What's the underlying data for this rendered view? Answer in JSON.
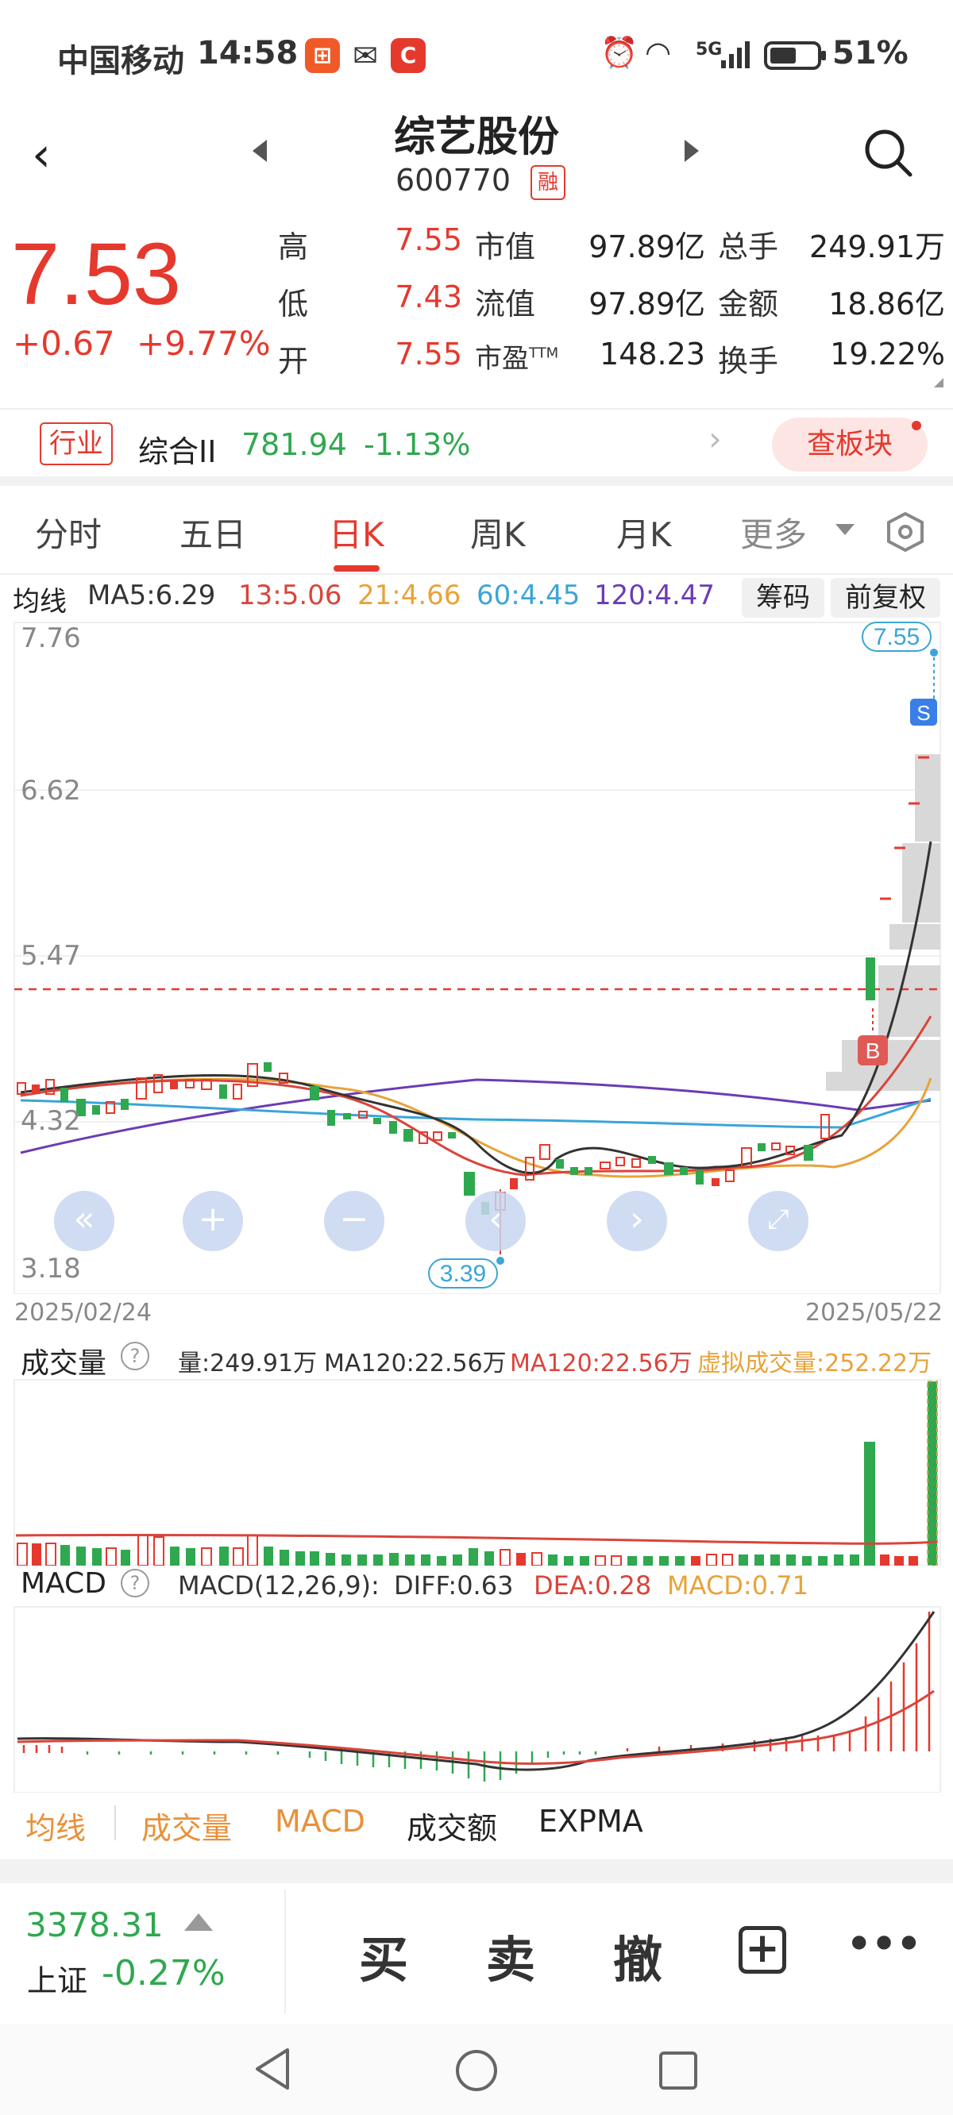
{
  "status_bar": {
    "carrier": "中国移动",
    "time": "14:58",
    "network": "5G",
    "battery": "51%"
  },
  "header": {
    "stock_name": "综艺股份",
    "stock_code": "600770",
    "margin_badge": "融"
  },
  "quote": {
    "price": "7.53",
    "change": "+0.67",
    "change_pct": "+9.77%",
    "rows": [
      [
        {
          "label": "高",
          "value": "7.55"
        },
        {
          "label": "市值",
          "value": "97.89亿"
        },
        {
          "label": "总手",
          "value": "249.91万"
        }
      ],
      [
        {
          "label": "低",
          "value": "7.43"
        },
        {
          "label": "流值",
          "value": "97.89亿"
        },
        {
          "label": "金额",
          "value": "18.86亿"
        }
      ],
      [
        {
          "label": "开",
          "value": "7.55"
        },
        {
          "label": "市盈",
          "label_sup": "TTM",
          "value": "148.23"
        },
        {
          "label": "换手",
          "value": "19.22%"
        }
      ]
    ]
  },
  "industry": {
    "badge": "行业",
    "name": "综合II",
    "value": "781.94",
    "change": "-1.13%",
    "sector_button": "查板块"
  },
  "tabs": [
    "分时",
    "五日",
    "日K",
    "周K",
    "月K",
    "更多"
  ],
  "active_tab": "日K",
  "ma_legend": {
    "label": "均线",
    "ma5": "MA5:6.29",
    "ma13": "13:5.06",
    "ma21": "21:4.66",
    "ma60": "60:4.45",
    "ma120": "120:4.47",
    "chip_button": "筹码",
    "adjust_button": "前复权"
  },
  "price_axis": [
    "7.76",
    "6.62",
    "5.47",
    "4.32",
    "3.18"
  ],
  "date_range": {
    "start": "2025/02/24",
    "end": "2025/05/22"
  },
  "markers": {
    "high_label": "7.55",
    "low_label": "3.39",
    "buy": "B",
    "sell": "S"
  },
  "volume_panel": {
    "title": "成交量",
    "vol": "量:249.91万",
    "ma120_a": "MA120:22.56万",
    "ma120_b": "MA120:22.56万",
    "virtual": "虚拟成交量:252.22万"
  },
  "macd_panel": {
    "title": "MACD",
    "params": "MACD(12,26,9):",
    "diff": "DIFF:0.63",
    "dea": "DEA:0.28",
    "macd": "MACD:0.71"
  },
  "indicator_tabs": [
    "均线",
    "成交量",
    "MACD",
    "成交额",
    "EXPMA"
  ],
  "index": {
    "value": "3378.31",
    "name": "上证",
    "change": "-0.27%"
  },
  "actions": {
    "buy": "买",
    "sell": "卖",
    "cancel": "撤"
  },
  "colors": {
    "up": "#e5392e",
    "down": "#2fa84f",
    "ma5": "#333333",
    "ma13": "#d9453b",
    "ma21": "#e8a33a",
    "ma60": "#3aa5d8",
    "ma120": "#6a3cb5"
  }
}
